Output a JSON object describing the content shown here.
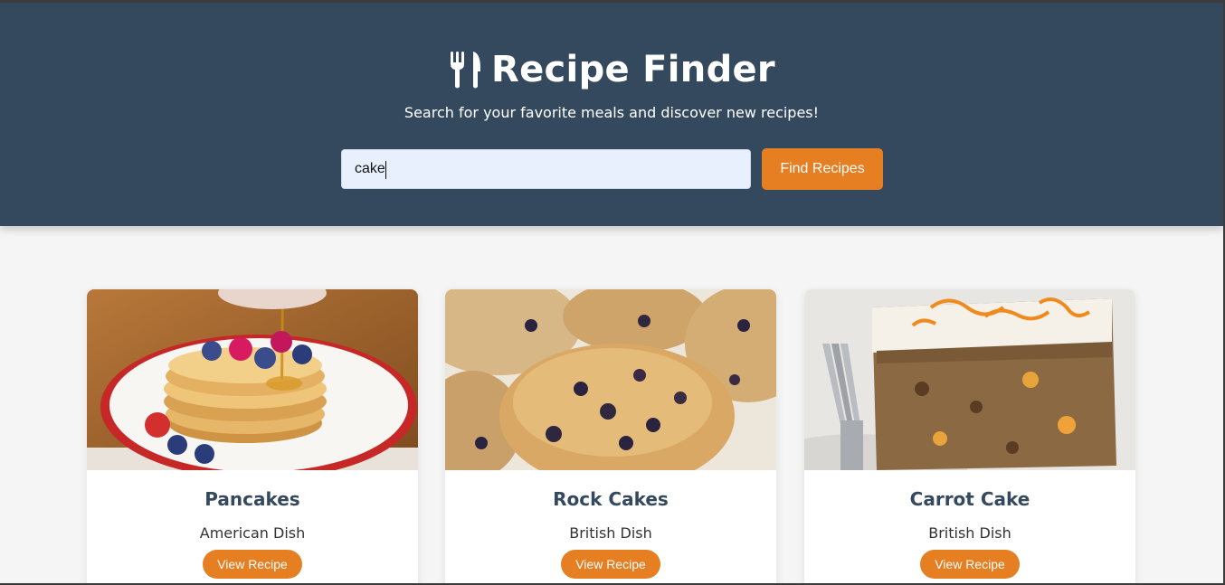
{
  "header": {
    "icon": "utensils-icon",
    "title": "Recipe Finder",
    "subtitle": "Search for your favorite meals and discover new recipes!",
    "colors": {
      "background": "#34495e",
      "accent": "#e67e22"
    }
  },
  "search": {
    "value": "cake",
    "button_label": "Find Recipes"
  },
  "recipes": [
    {
      "name": "Pancakes",
      "area": "American Dish",
      "button_label": "View Recipe",
      "image": "pancakes-photo"
    },
    {
      "name": "Rock Cakes",
      "area": "British Dish",
      "button_label": "View Recipe",
      "image": "rock-cakes-photo"
    },
    {
      "name": "Carrot Cake",
      "area": "British Dish",
      "button_label": "View Recipe",
      "image": "carrot-cake-photo"
    }
  ]
}
